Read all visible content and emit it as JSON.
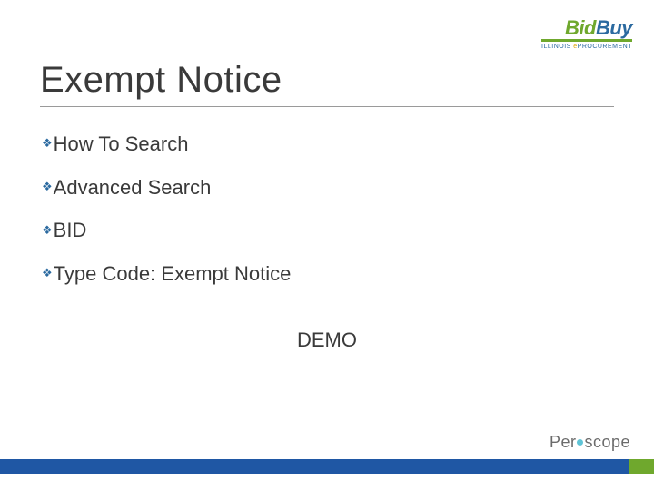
{
  "header": {
    "logo": {
      "part1": "Bid",
      "part2": "Buy",
      "subtitle_pre": "ILLINOIS ",
      "subtitle_mid": "e",
      "subtitle_post": "PROCUREMENT"
    }
  },
  "title": "Exempt Notice",
  "bullets": [
    "How To Search",
    "Advanced Search",
    "BID",
    "Type Code:  Exempt Notice"
  ],
  "demo": "DEMO",
  "footer": {
    "logo_pre": "Per",
    "logo_post": "scope"
  }
}
